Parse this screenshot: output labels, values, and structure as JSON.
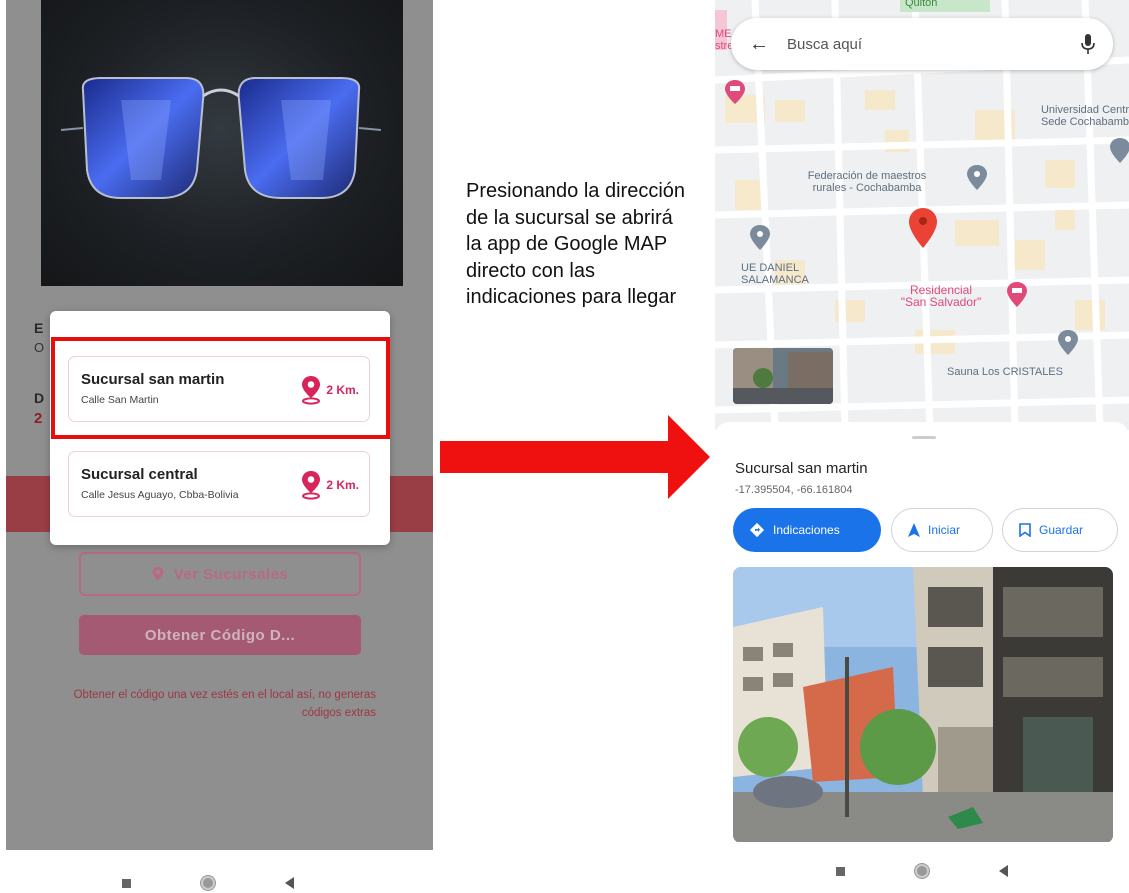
{
  "left_phone": {
    "background_letters": [
      "E",
      "O",
      "D",
      "2"
    ],
    "branches": [
      {
        "name": "Sucursal san martin",
        "address": "Calle San Martin",
        "distance": "2 Km."
      },
      {
        "name": "Sucursal central",
        "address": "Calle Jesus Aguayo, Cbba-Bolivia",
        "distance": "2 Km."
      }
    ],
    "ver_sucursales_label": "Ver Sucursales",
    "obtener_codigo_label": "Obtener Código D...",
    "note": "Obtener el código una vez estés en el local así, no generas códigos extras"
  },
  "caption": "Presionando la dirección de la sucursal se abrirá la app de Google MAP directo con las indicaciones para llegar",
  "right_phone": {
    "search_placeholder": "Busca aquí",
    "map_labels": {
      "top_road": "Quiton",
      "university": "Universidad Centr\nSede Cochabamb",
      "federacion": "Federación de maestros\nrurales - Cochabamba",
      "school": "UE DANIEL\nSALAMANCA",
      "residencial": "Residencial\n\"San Salvador\"",
      "sauna": "Sauna Los CRISTALES",
      "left_edge": "ME\nstrel"
    },
    "place_name": "Sucursal san martin",
    "place_coords": "-17.395504, -66.161804",
    "actions": {
      "directions": "Indicaciones",
      "start": "Iniciar",
      "save": "Guardar"
    }
  },
  "colors": {
    "highlight_red": "#e80e0e",
    "brand_pink": "#d8245a",
    "google_blue": "#1a73e8",
    "pin_red": "#ea4335"
  }
}
